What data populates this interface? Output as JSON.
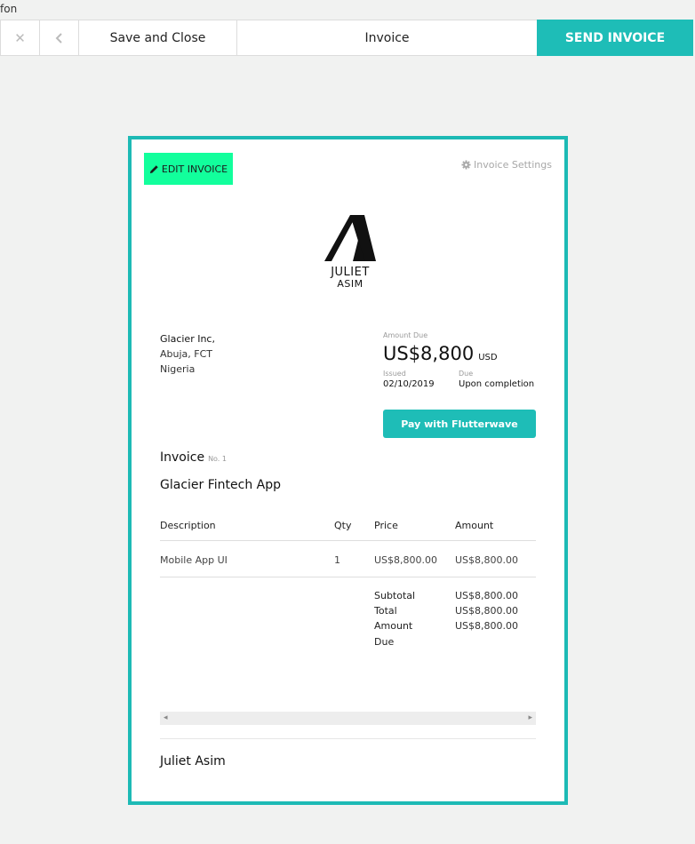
{
  "corner_text": "fon",
  "toolbar": {
    "close_icon": "x-icon",
    "back_icon": "chevron-left-icon",
    "save_label": "Save and Close",
    "title": "Invoice",
    "send_label": "SEND INVOICE",
    "send_color": "#1ebdb7"
  },
  "card": {
    "border_color": "#1dbab5",
    "edit_label": "EDIT INVOICE",
    "edit_color": "#12ff9c",
    "settings_label": "Invoice Settings",
    "logo_name": "JULIET",
    "logo_sub": "ASIM",
    "client": {
      "name": "Glacier Inc,",
      "city": "Abuja, FCT",
      "country": "Nigeria"
    },
    "amount_due_label": "Amount Due",
    "amount_due": "US$8,800",
    "currency": "USD",
    "issued_label": "Issued",
    "issued_date": "02/10/2019",
    "due_label": "Due",
    "due_value": "Upon completion",
    "pay_label": "Pay with Flutterwave",
    "invoice_word": "Invoice",
    "invoice_no": "No. 1",
    "project_title": "Glacier Fintech App",
    "table": {
      "headers": [
        "Description",
        "Qty",
        "Price",
        "Amount"
      ],
      "rows": [
        [
          "Mobile App UI",
          "1",
          "US$8,800.00",
          "US$8,800.00"
        ]
      ]
    },
    "totals": {
      "subtotal_label": "Subtotal",
      "subtotal": "US$8,800.00",
      "total_label": "Total",
      "total": "US$8,800.00",
      "amount_due_label_1": "Amount",
      "amount_due_label_2": "Due",
      "amount_due": "US$8,800.00"
    },
    "footer_name": "Juliet Asim"
  }
}
